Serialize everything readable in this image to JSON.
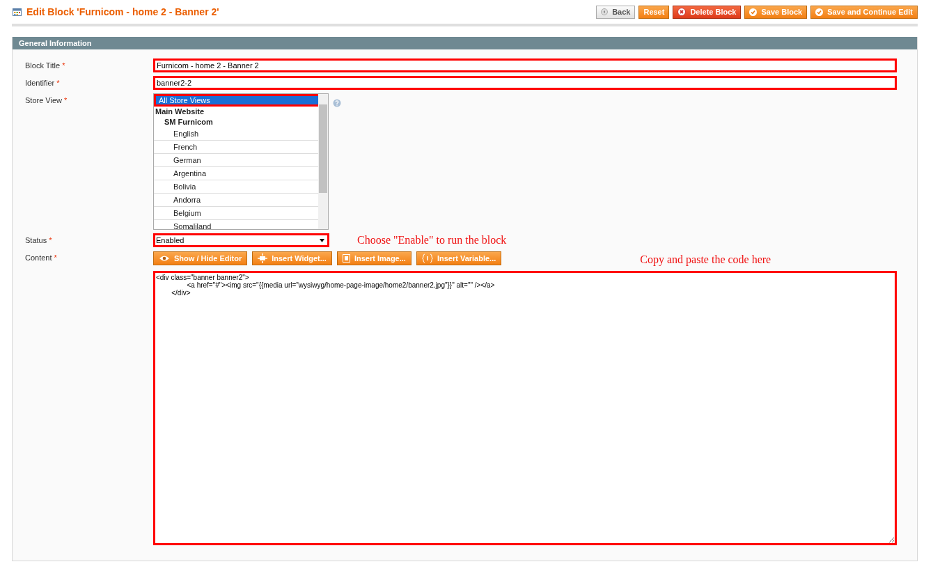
{
  "header": {
    "title": "Edit Block 'Furnicom - home 2 - Banner 2'"
  },
  "buttons": [
    {
      "label": "Back",
      "kind": "back"
    },
    {
      "label": "Reset",
      "kind": "plain"
    },
    {
      "label": "Delete Block",
      "kind": "delete"
    },
    {
      "label": "Save Block",
      "kind": "save"
    },
    {
      "label": "Save and Continue Edit",
      "kind": "save"
    }
  ],
  "section": {
    "title": "General Information"
  },
  "fields": [
    {
      "label": "Block Title",
      "required": "*",
      "kind": "text",
      "value": "Furnicom - home 2 - Banner 2",
      "annotated": true
    },
    {
      "label": "Identifier",
      "required": "*",
      "kind": "text",
      "value": "banner2-2",
      "annotated": true
    },
    {
      "label": "Store View",
      "required": "*",
      "kind": "multiselect",
      "options": [
        {
          "label": "All Store Views",
          "kind": "option",
          "selected": true,
          "annotated": true
        },
        {
          "label": "Main Website",
          "kind": "group",
          "children": [
            {
              "label": "SM Furnicom",
              "kind": "group",
              "children": [
                {
                  "label": "English",
                  "kind": "option",
                  "selected": false
                },
                {
                  "label": "French",
                  "kind": "option",
                  "selected": false
                },
                {
                  "label": "German",
                  "kind": "option",
                  "selected": false
                },
                {
                  "label": "Argentina",
                  "kind": "option",
                  "selected": false
                },
                {
                  "label": "Bolivia",
                  "kind": "option",
                  "selected": false
                },
                {
                  "label": "Andorra",
                  "kind": "option",
                  "selected": false
                },
                {
                  "label": "Belgium",
                  "kind": "option",
                  "selected": false
                },
                {
                  "label": "Somaliland",
                  "kind": "option",
                  "selected": false
                }
              ]
            }
          ]
        }
      ]
    },
    {
      "label": "Status",
      "required": "*",
      "kind": "select",
      "value": "Enabled",
      "annotated": true,
      "note": "Choose \"Enable\" to run the block"
    },
    {
      "label": "Content",
      "required": "*",
      "kind": "editor",
      "note": "Copy and paste the code here",
      "annotated": true,
      "tools": [
        {
          "label": "Show / Hide Editor",
          "kind": "eye"
        },
        {
          "label": "Insert Widget...",
          "kind": "widget"
        },
        {
          "label": "Insert Image...",
          "kind": "image"
        },
        {
          "label": "Insert Variable...",
          "kind": "variable"
        }
      ],
      "value": "<div class=\"banner banner2\">\n\t\t<a href=\"#\"><img src=\"{{media url=\"wysiwyg/home-page-image/home2/banner2.jpg\"}}\" alt=\"\" /></a>\n\t</div>"
    }
  ]
}
